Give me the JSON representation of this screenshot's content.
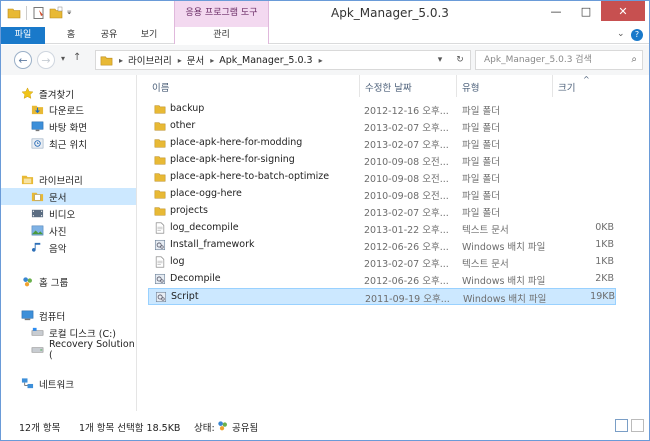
{
  "window": {
    "title": "Apk_Manager_5.0.3",
    "context_tab_group": "응용 프로그램 도구",
    "controls": {
      "minimize": "—",
      "maximize": "□",
      "close": "✕"
    }
  },
  "ribbon": {
    "tabs": [
      "파일",
      "홈",
      "공유",
      "보기",
      "관리"
    ],
    "expand_symbol": "⌄",
    "help_symbol": "?"
  },
  "address_bar": {
    "breadcrumbs": [
      "라이브러리",
      "문서",
      "Apk_Manager_5.0.3"
    ],
    "search_placeholder": "Apk_Manager_5.0.3 검색"
  },
  "nav_pane": {
    "items": [
      {
        "label": "즐겨찾기",
        "icon": "star-icon",
        "level": 0
      },
      {
        "label": "다운로드",
        "icon": "download-folder-icon",
        "level": 1
      },
      {
        "label": "바탕 화면",
        "icon": "desktop-icon",
        "level": 1
      },
      {
        "label": "최근 위치",
        "icon": "recent-places-icon",
        "level": 1
      },
      {
        "label": "라이브러리",
        "icon": "library-icon",
        "level": 0
      },
      {
        "label": "문서",
        "icon": "documents-icon",
        "level": 1,
        "selected": true
      },
      {
        "label": "비디오",
        "icon": "video-icon",
        "level": 1
      },
      {
        "label": "사진",
        "icon": "pictures-icon",
        "level": 1
      },
      {
        "label": "음악",
        "icon": "music-icon",
        "level": 1
      },
      {
        "label": "홈 그룹",
        "icon": "homegroup-icon",
        "level": 0
      },
      {
        "label": "컴퓨터",
        "icon": "computer-icon",
        "level": 0
      },
      {
        "label": "로컬 디스크 (C:)",
        "icon": "local-disk-icon",
        "level": 1
      },
      {
        "label": "Recovery Solution (",
        "icon": "drive-icon",
        "level": 1
      },
      {
        "label": "네트워크",
        "icon": "network-icon",
        "level": 0
      }
    ]
  },
  "file_list": {
    "columns": [
      "이름",
      "수정한 날짜",
      "유형",
      "크기"
    ],
    "sort_indicator": "^",
    "rows": [
      {
        "name": "backup",
        "date": "2012-12-16 오후...",
        "type": "파일 폴더",
        "size": "",
        "icon": "folder"
      },
      {
        "name": "other",
        "date": "2013-02-07 오후...",
        "type": "파일 폴더",
        "size": "",
        "icon": "folder"
      },
      {
        "name": "place-apk-here-for-modding",
        "date": "2013-02-07 오후...",
        "type": "파일 폴더",
        "size": "",
        "icon": "folder"
      },
      {
        "name": "place-apk-here-for-signing",
        "date": "2010-09-08 오전...",
        "type": "파일 폴더",
        "size": "",
        "icon": "folder"
      },
      {
        "name": "place-apk-here-to-batch-optimize",
        "date": "2010-09-08 오전...",
        "type": "파일 폴더",
        "size": "",
        "icon": "folder"
      },
      {
        "name": "place-ogg-here",
        "date": "2010-09-08 오전...",
        "type": "파일 폴더",
        "size": "",
        "icon": "folder"
      },
      {
        "name": "projects",
        "date": "2013-02-07 오후...",
        "type": "파일 폴더",
        "size": "",
        "icon": "folder"
      },
      {
        "name": "log_decompile",
        "date": "2013-01-22 오후...",
        "type": "텍스트 문서",
        "size": "0KB",
        "icon": "text"
      },
      {
        "name": "Install_framework",
        "date": "2012-06-26 오후...",
        "type": "Windows 배치 파일",
        "size": "1KB",
        "icon": "batch"
      },
      {
        "name": "log",
        "date": "2013-02-07 오후...",
        "type": "텍스트 문서",
        "size": "1KB",
        "icon": "text"
      },
      {
        "name": "Decompile",
        "date": "2012-06-26 오후...",
        "type": "Windows 배치 파일",
        "size": "2KB",
        "icon": "batch"
      },
      {
        "name": "Script",
        "date": "2011-09-19 오후...",
        "type": "Windows 배치 파일",
        "size": "19KB",
        "icon": "batch",
        "selected": true
      }
    ]
  },
  "status_bar": {
    "item_count": "12개 항목",
    "selection": "1개 항목 선택함 18.5KB",
    "state_label": "상태:",
    "state_value": "공유됨"
  },
  "colors": {
    "file_tab": "#1979ca",
    "context_tab": "#f3d9f0",
    "selection": "#cce8ff",
    "close_button": "#c75050",
    "folder": "#e8b935"
  }
}
